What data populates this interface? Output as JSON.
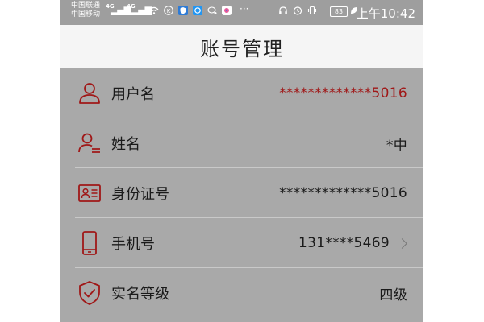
{
  "status_bar": {
    "carrier1": "中国联通",
    "carrier2": "中国移动",
    "network1": "4G",
    "network2": "4G",
    "more": "···",
    "battery": "83",
    "time": "上午10:42"
  },
  "title": "账号管理",
  "rows": [
    {
      "label": "用户名",
      "value": "*************5016",
      "icon": "person-icon",
      "value_color": "#a01818"
    },
    {
      "label": "姓名",
      "value": "*中",
      "icon": "person-list-icon"
    },
    {
      "label": "身份证号",
      "value": "*************5016",
      "icon": "id-card-icon"
    },
    {
      "label": "手机号",
      "value": "131****5469",
      "icon": "phone-icon"
    },
    {
      "label": "实名等级",
      "value": "四级",
      "icon": "shield-check-icon"
    }
  ],
  "colors": {
    "accent": "#a01818",
    "background": "#a9a9a9",
    "header": "#f5f5f5"
  }
}
